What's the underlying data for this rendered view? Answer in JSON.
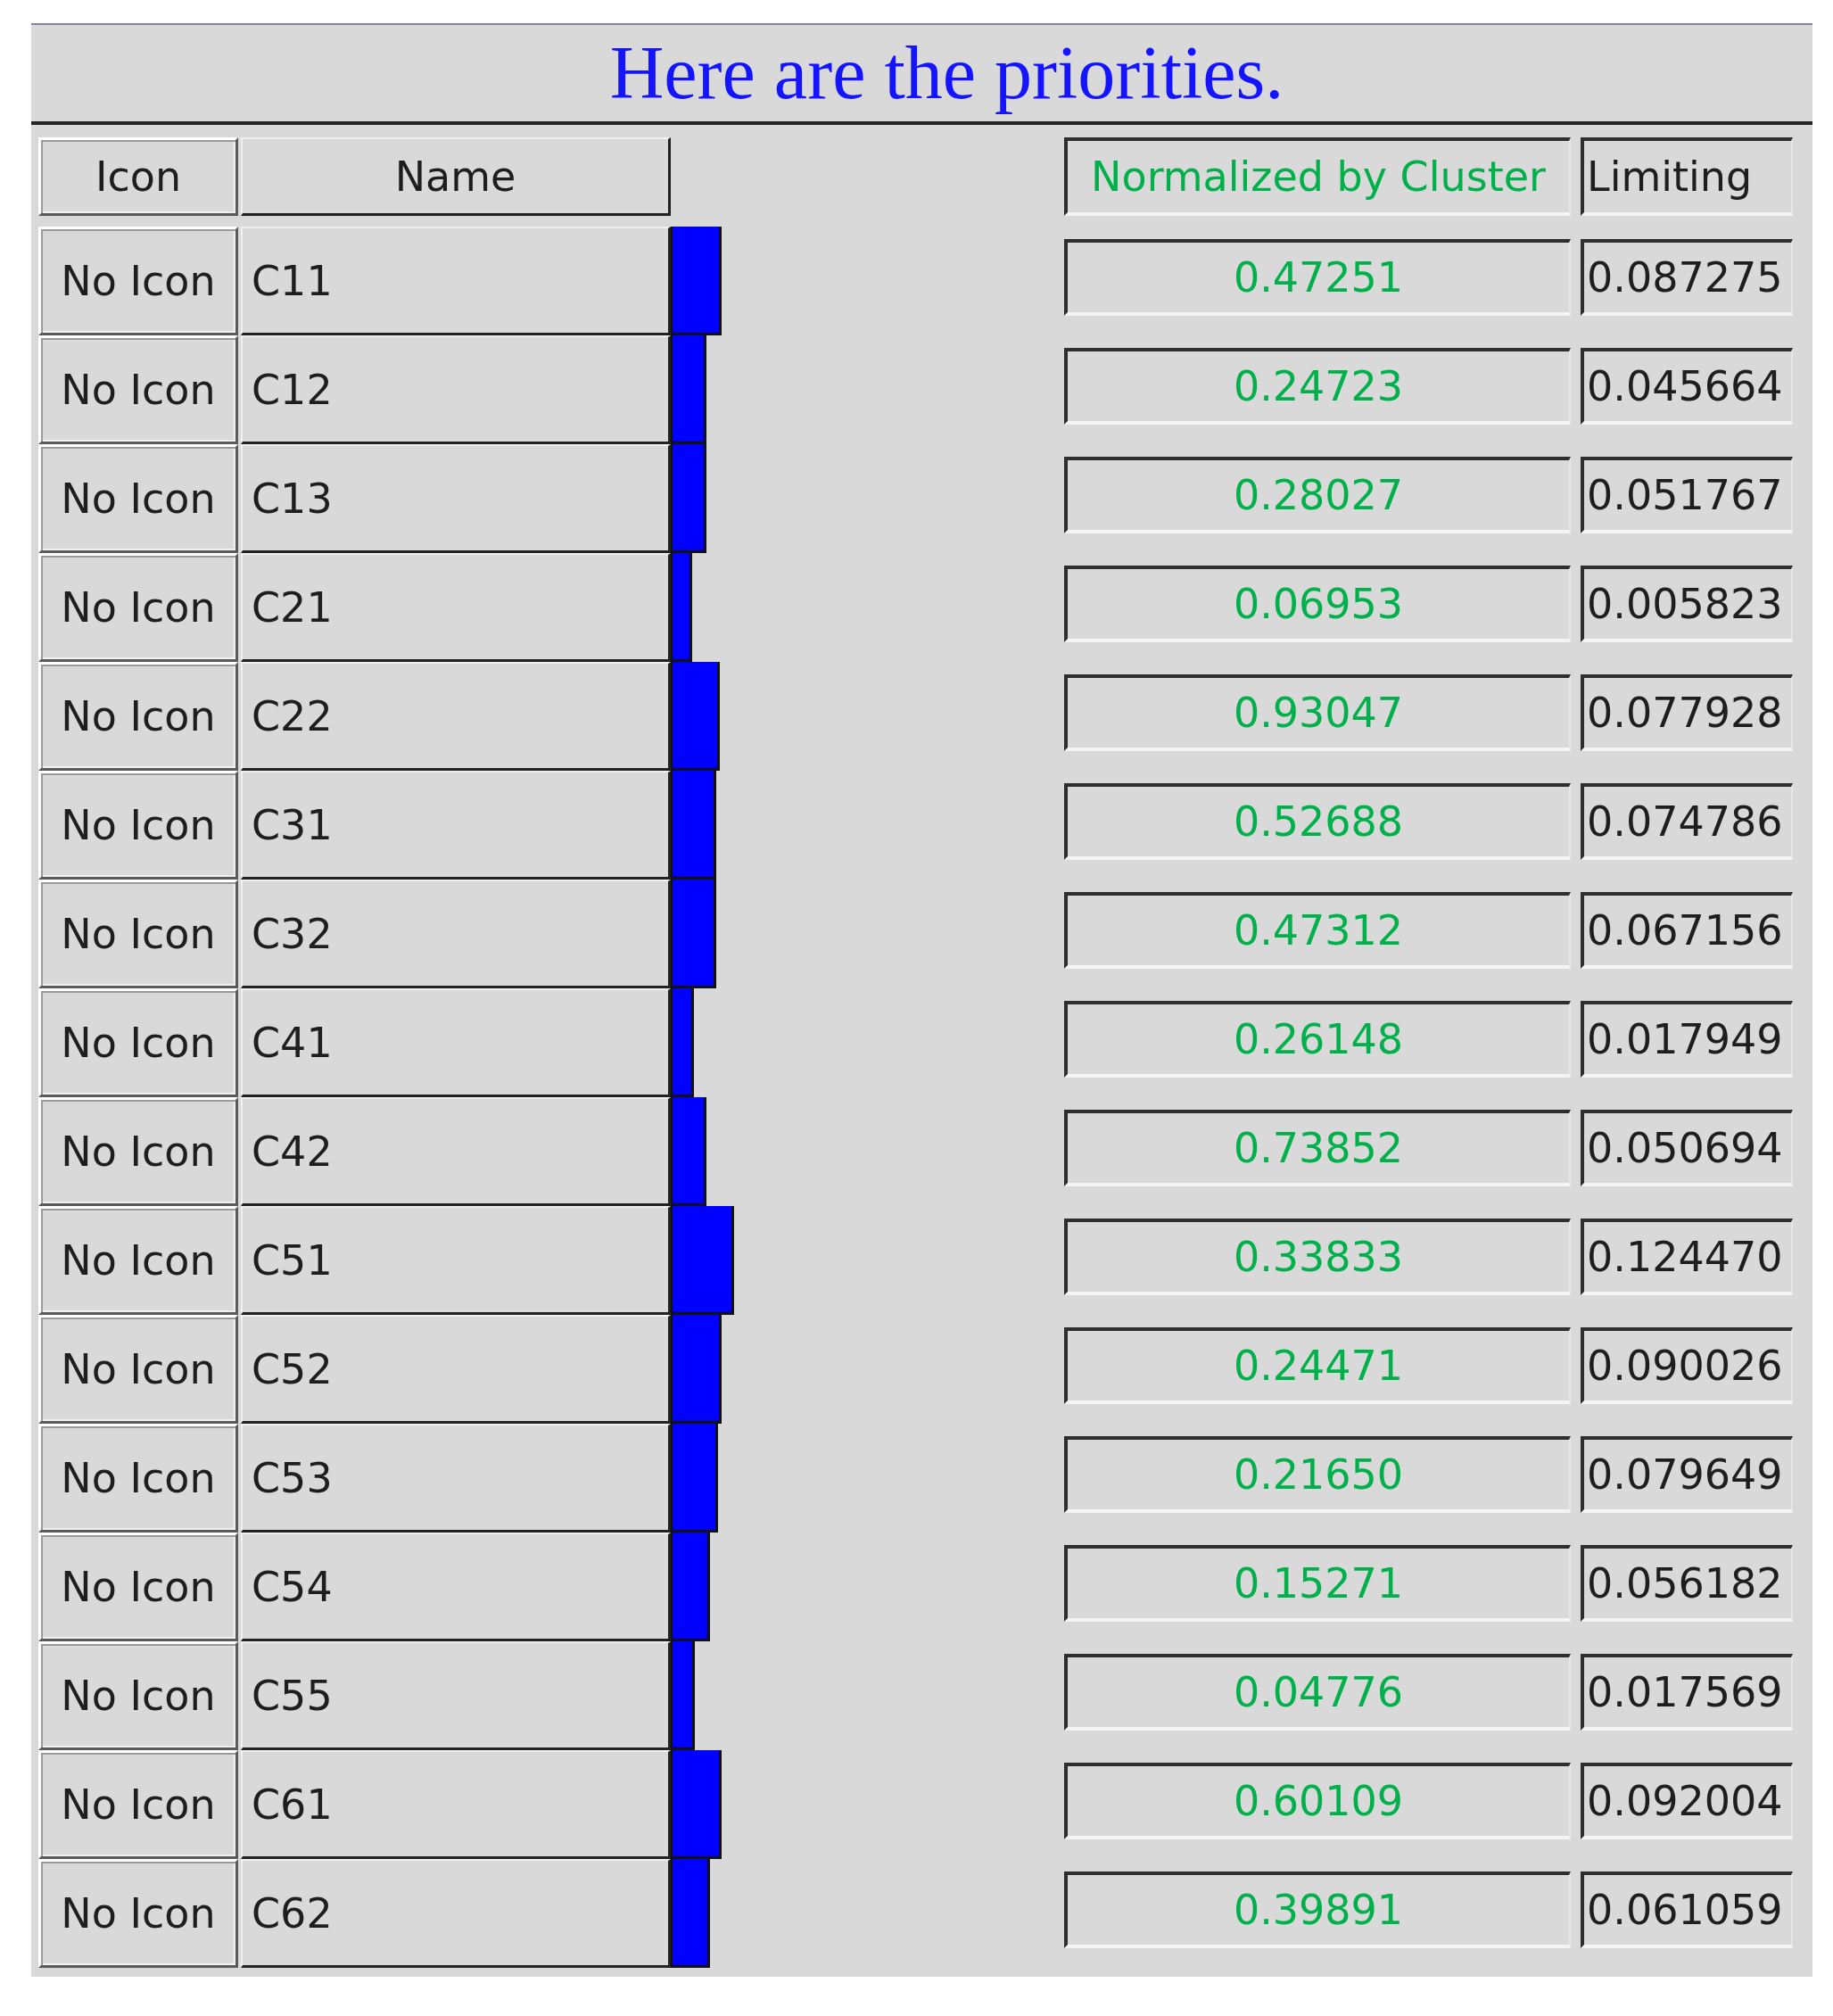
{
  "title": "Here are the priorities.",
  "table": {
    "columns": [
      "Icon",
      "Name",
      "Normalized by Cluster",
      "Limiting"
    ],
    "rows": [
      {
        "icon": "No Icon",
        "name": "C11",
        "level": 0.13,
        "normalized": "0.47251",
        "limiting": "0.087275"
      },
      {
        "icon": "No Icon",
        "name": "C12",
        "level": 0.09,
        "normalized": "0.24723",
        "limiting": "0.045664"
      },
      {
        "icon": "No Icon",
        "name": "C13",
        "level": 0.09,
        "normalized": "0.28027",
        "limiting": "0.051767"
      },
      {
        "icon": "No Icon",
        "name": "C21",
        "level": 0.055,
        "normalized": "0.06953",
        "limiting": "0.005823"
      },
      {
        "icon": "No Icon",
        "name": "C22",
        "level": 0.125,
        "normalized": "0.93047",
        "limiting": "0.077928"
      },
      {
        "icon": "No Icon",
        "name": "C31",
        "level": 0.115,
        "normalized": "0.52688",
        "limiting": "0.074786"
      },
      {
        "icon": "No Icon",
        "name": "C32",
        "level": 0.115,
        "normalized": "0.47312",
        "limiting": "0.067156"
      },
      {
        "icon": "No Icon",
        "name": "C41",
        "level": 0.06,
        "normalized": "0.26148",
        "limiting": "0.017949"
      },
      {
        "icon": "No Icon",
        "name": "C42",
        "level": 0.09,
        "normalized": "0.73852",
        "limiting": "0.050694"
      },
      {
        "icon": "No Icon",
        "name": "C51",
        "level": 0.16,
        "normalized": "0.33833",
        "limiting": "0.124470"
      },
      {
        "icon": "No Icon",
        "name": "C52",
        "level": 0.13,
        "normalized": "0.24471",
        "limiting": "0.090026"
      },
      {
        "icon": "No Icon",
        "name": "C53",
        "level": 0.12,
        "normalized": "0.21650",
        "limiting": "0.079649"
      },
      {
        "icon": "No Icon",
        "name": "C54",
        "level": 0.1,
        "normalized": "0.15271",
        "limiting": "0.056182"
      },
      {
        "icon": "No Icon",
        "name": "C55",
        "level": 0.062,
        "normalized": "0.04776",
        "limiting": "0.017569"
      },
      {
        "icon": "No Icon",
        "name": "C61",
        "level": 0.13,
        "normalized": "0.60109",
        "limiting": "0.092004"
      },
      {
        "icon": "No Icon",
        "name": "C62",
        "level": 0.1,
        "normalized": "0.39891",
        "limiting": "0.061059"
      }
    ]
  }
}
